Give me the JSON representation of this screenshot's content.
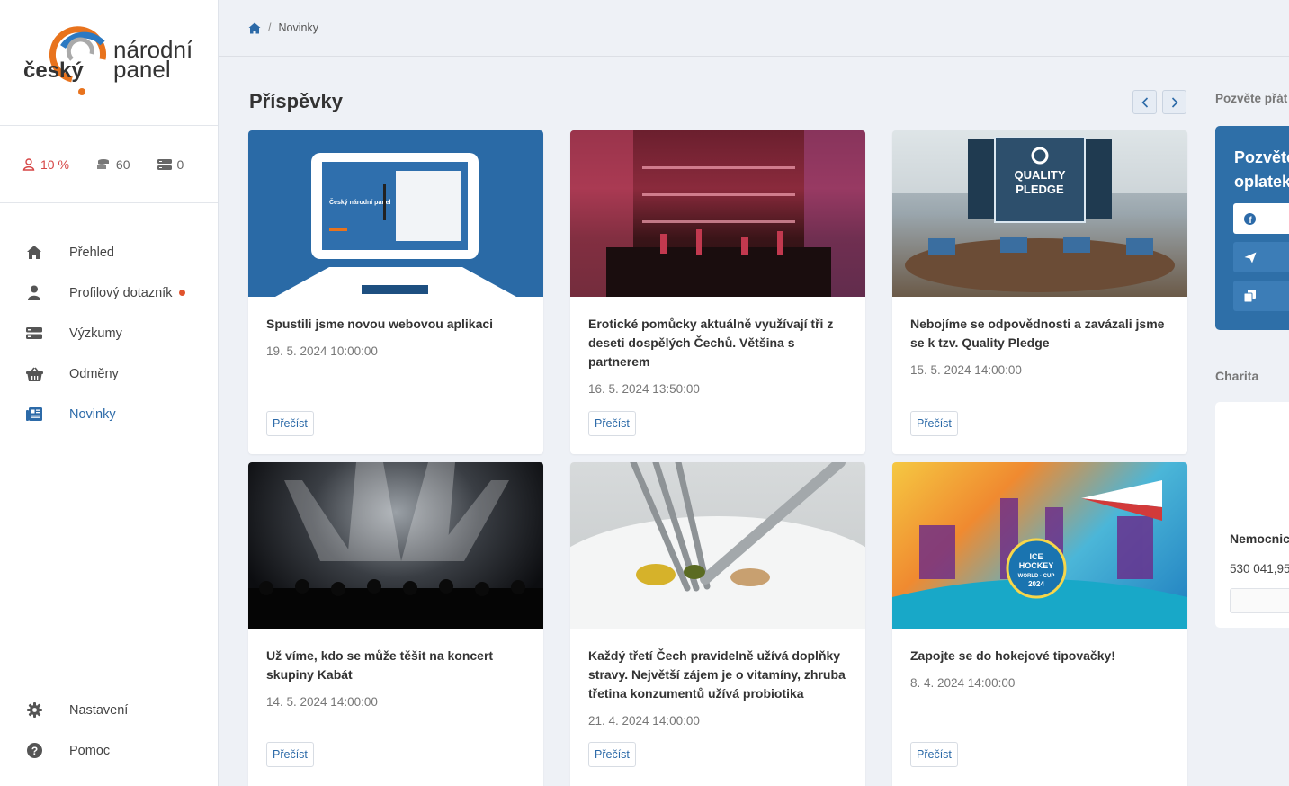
{
  "brand": {
    "line1": "český",
    "line2": "národní",
    "line3": "panel"
  },
  "stats": {
    "profile_percent": "10 %",
    "points": "60",
    "surveys": "0"
  },
  "nav": {
    "items": [
      {
        "label": "Přehled",
        "icon": "home-icon"
      },
      {
        "label": "Profilový dotazník",
        "icon": "user-icon"
      },
      {
        "label": "Výzkumy",
        "icon": "surveys-icon"
      },
      {
        "label": "Odměny",
        "icon": "basket-icon"
      },
      {
        "label": "Novinky",
        "icon": "newspaper-icon"
      }
    ],
    "bottom": [
      {
        "label": "Nastavení",
        "icon": "gear-icon"
      },
      {
        "label": "Pomoc",
        "icon": "help-icon"
      }
    ]
  },
  "breadcrumb": {
    "home_icon": "home-icon",
    "separator": "/",
    "current": "Novinky"
  },
  "main": {
    "heading": "Příspěvky",
    "read_label": "Přečíst",
    "posts": [
      {
        "title": "Spustili jsme novou webovou aplikaci",
        "date": "19. 5. 2024 10:00:00"
      },
      {
        "title": "Erotické pomůcky aktuálně využívají tři z deseti dospělých Čechů. Většina s partnerem",
        "date": "16. 5. 2024 13:50:00"
      },
      {
        "title": "Nebojíme se odpovědnosti a zavázali jsme se k tzv. Quality Pledge",
        "date": "15. 5. 2024 14:00:00"
      },
      {
        "title": "Už víme, kdo se může těšit na koncert skupiny Kabát",
        "date": "14. 5. 2024 14:00:00"
      },
      {
        "title": "Každý třetí Čech pravidelně užívá doplňky stravy. Největší zájem je o vitamíny, zhruba třetina konzumentů užívá probiotika",
        "date": "21. 4. 2024 14:00:00"
      },
      {
        "title": "Zapojte se do hokejové tipovačky!",
        "date": "8. 4. 2024 14:00:00"
      }
    ]
  },
  "image_texts": {
    "app_screen": "Český národní panel",
    "quality_line1": "QUALITY",
    "quality_line2": "PLEDGE",
    "hockey_line1": "ICE",
    "hockey_line2": "HOCKEY",
    "hockey_line3": "WORLD · CUP",
    "hockey_line4": "2024"
  },
  "right": {
    "invite_label": "Pozvěte přát",
    "invite_title_1": "Pozvěte",
    "invite_title_2": "oplatek",
    "charity_label": "Charita",
    "charity_name": "Nemocnic",
    "charity_amount": "530 041,95"
  },
  "colors": {
    "accent": "#2c6aa8",
    "alert": "#d64545",
    "invite_bg": "#2e6fa8",
    "logo_orange": "#e8731d",
    "logo_blue": "#2b79c2"
  }
}
